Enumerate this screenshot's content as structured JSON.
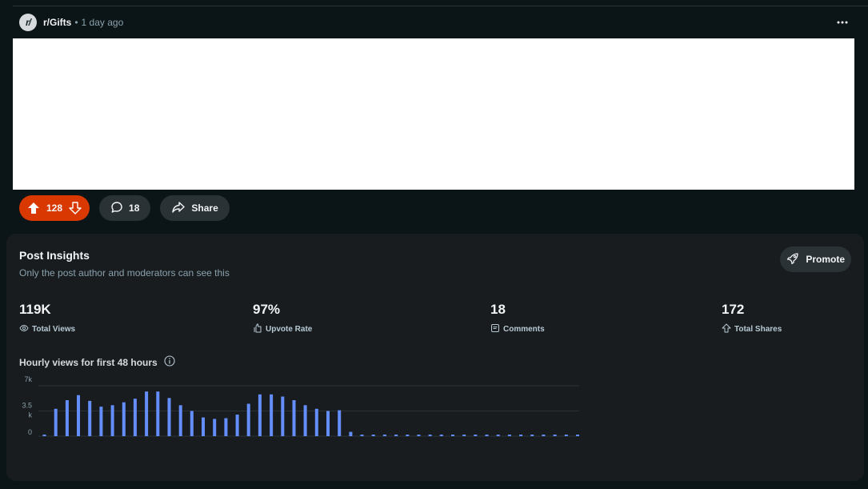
{
  "post": {
    "subreddit": "r/Gifts",
    "separator": "•",
    "time_ago": "1 day ago",
    "avatar_text": "r/"
  },
  "actions": {
    "vote_count": "128",
    "comment_count": "18",
    "share_label": "Share"
  },
  "insights": {
    "title": "Post Insights",
    "subtitle": "Only the post author and moderators can see this",
    "promote_label": "Promote",
    "stats": [
      {
        "value": "119K",
        "label": "Total Views",
        "icon": "eye-icon"
      },
      {
        "value": "97%",
        "label": "Upvote Rate",
        "icon": "upvote-hand-icon"
      },
      {
        "value": "18",
        "label": "Comments",
        "icon": "comment-box-icon"
      },
      {
        "value": "172",
        "label": "Total Shares",
        "icon": "share-arrow-icon"
      }
    ],
    "chart_title": "Hourly views for first 48 hours"
  },
  "colors": {
    "accent_vote": "#d93900",
    "bar": "#648efc",
    "background": "#0b1416",
    "panel": "#181c1f"
  },
  "chart_data": {
    "type": "bar",
    "title": "Hourly views for first 48 hours",
    "x": [
      1,
      2,
      3,
      4,
      5,
      6,
      7,
      8,
      9,
      10,
      11,
      12,
      13,
      14,
      15,
      16,
      17,
      18,
      19,
      20,
      21,
      22,
      23,
      24,
      25,
      26,
      27,
      28,
      29,
      30,
      31,
      32,
      33,
      34,
      35,
      36,
      37,
      38,
      39,
      40,
      41,
      42,
      43,
      44,
      45,
      46,
      47,
      48
    ],
    "values": [
      200,
      3800,
      5000,
      5700,
      4900,
      4100,
      4300,
      4700,
      5200,
      6200,
      6200,
      5300,
      4300,
      3500,
      2600,
      2400,
      2500,
      3000,
      4500,
      5800,
      5800,
      5500,
      5000,
      4300,
      3800,
      3500,
      3600,
      600,
      0,
      0,
      0,
      0,
      0,
      0,
      0,
      0,
      0,
      0,
      0,
      0,
      0,
      0,
      0,
      0,
      0,
      0,
      0,
      0
    ],
    "ytick_labels": [
      {
        "text": "7k",
        "value": 7000
      },
      {
        "text": "3.5",
        "value": 3500
      },
      {
        "text": "k",
        "value": 3500,
        "suffix_row": true
      },
      {
        "text": "0",
        "value": 0
      }
    ],
    "ylim": [
      0,
      7000
    ],
    "grid": true,
    "xlabel": "",
    "ylabel": ""
  }
}
